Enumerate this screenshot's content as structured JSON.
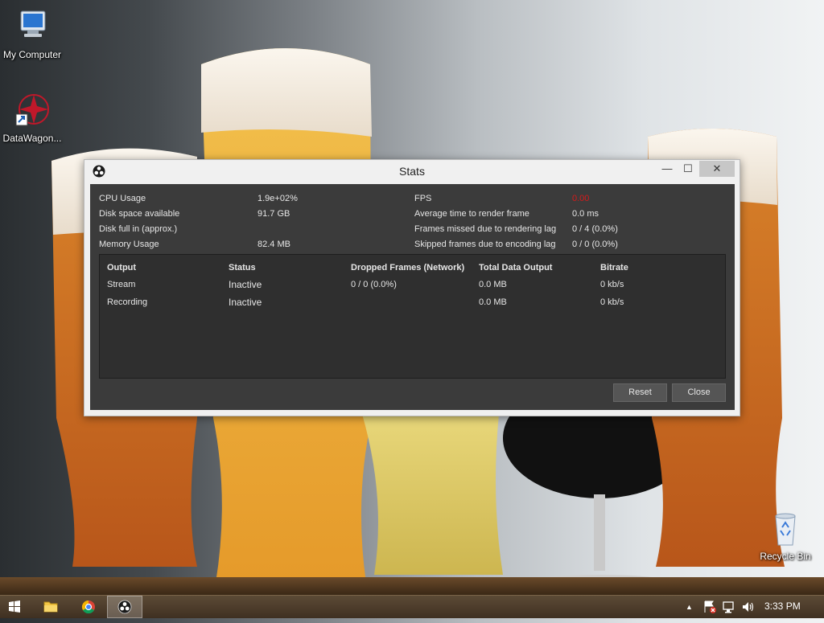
{
  "desktop": {
    "icons": [
      {
        "label": "My Computer"
      },
      {
        "label": "DataWagon..."
      },
      {
        "label": "Recycle Bin"
      }
    ]
  },
  "window": {
    "title": "Stats",
    "controls": {
      "minimize": "—",
      "maximize": "☐",
      "close": "✕"
    },
    "stats_left": [
      {
        "label": "CPU Usage",
        "value": "1.9e+02%"
      },
      {
        "label": "Disk space available",
        "value": "91.7 GB"
      },
      {
        "label": "Disk full in (approx.)",
        "value": ""
      },
      {
        "label": "Memory Usage",
        "value": "82.4 MB"
      }
    ],
    "stats_right": [
      {
        "label": "FPS",
        "value": "0.00",
        "color": "#d61a1a"
      },
      {
        "label": "Average time to render frame",
        "value": "0.0 ms"
      },
      {
        "label": "Frames missed due to rendering lag",
        "value": "0 / 4 (0.0%)"
      },
      {
        "label": "Skipped frames due to encoding lag",
        "value": "0 / 0 (0.0%)"
      }
    ],
    "outputs": {
      "headers": [
        "Output",
        "Status",
        "Dropped Frames (Network)",
        "Total Data Output",
        "Bitrate"
      ],
      "rows": [
        [
          "Stream",
          "Inactive",
          "0 / 0 (0.0%)",
          "0.0 MB",
          "0 kb/s"
        ],
        [
          "Recording",
          "Inactive",
          "",
          "0.0 MB",
          "0 kb/s"
        ]
      ]
    },
    "buttons": {
      "reset": "Reset",
      "close": "Close"
    }
  },
  "taskbar": {
    "items": [
      {
        "icon": "windows-start-icon"
      },
      {
        "icon": "file-explorer-icon"
      },
      {
        "icon": "chrome-icon"
      },
      {
        "icon": "obs-icon",
        "active": true
      }
    ],
    "tray": {
      "chevron": "▲",
      "clock": "3:33 PM"
    }
  },
  "colors": {
    "client_bg": "#3b3b3b",
    "fps_red": "#d61a1a",
    "taskbar": "#4a3a2a"
  }
}
